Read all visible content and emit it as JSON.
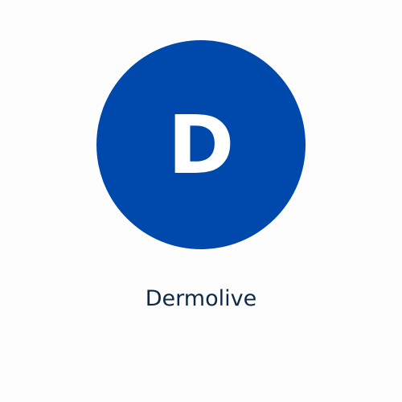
{
  "app": {
    "initial": "D",
    "name": "Dermolive",
    "brand_color": "#0049ac",
    "initial_color": "#ffffff",
    "name_color": "#0f2a45"
  }
}
